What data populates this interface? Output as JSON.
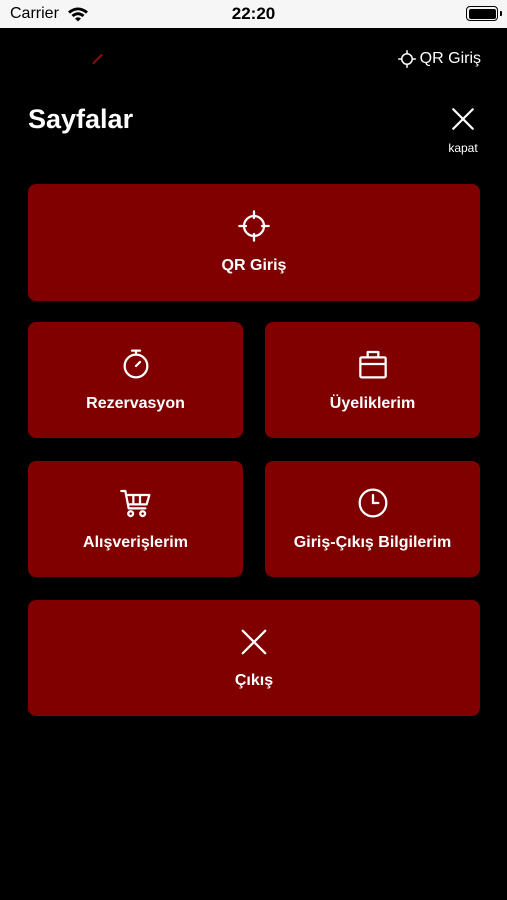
{
  "status_bar": {
    "carrier": "Carrier",
    "time": "22:20",
    "battery_level": 1.0
  },
  "header": {
    "qr_label": "QR Giriş",
    "qr_icon": "crosshair-icon"
  },
  "page": {
    "title": "Sayfalar",
    "close_label": "kapat",
    "close_icon": "close-icon"
  },
  "menu": {
    "tile_color": "#800000",
    "items": [
      {
        "label": "QR Giriş",
        "icon": "crosshair-icon"
      },
      {
        "label": "Rezervasyon",
        "icon": "stopwatch-icon"
      },
      {
        "label": "Üyeliklerim",
        "icon": "bag-icon"
      },
      {
        "label": "Alışverişlerim",
        "icon": "cart-icon"
      },
      {
        "label": "Giriş-Çıkış Bilgilerim",
        "icon": "clock-icon"
      },
      {
        "label": "Çıkış",
        "icon": "close-icon"
      }
    ]
  }
}
